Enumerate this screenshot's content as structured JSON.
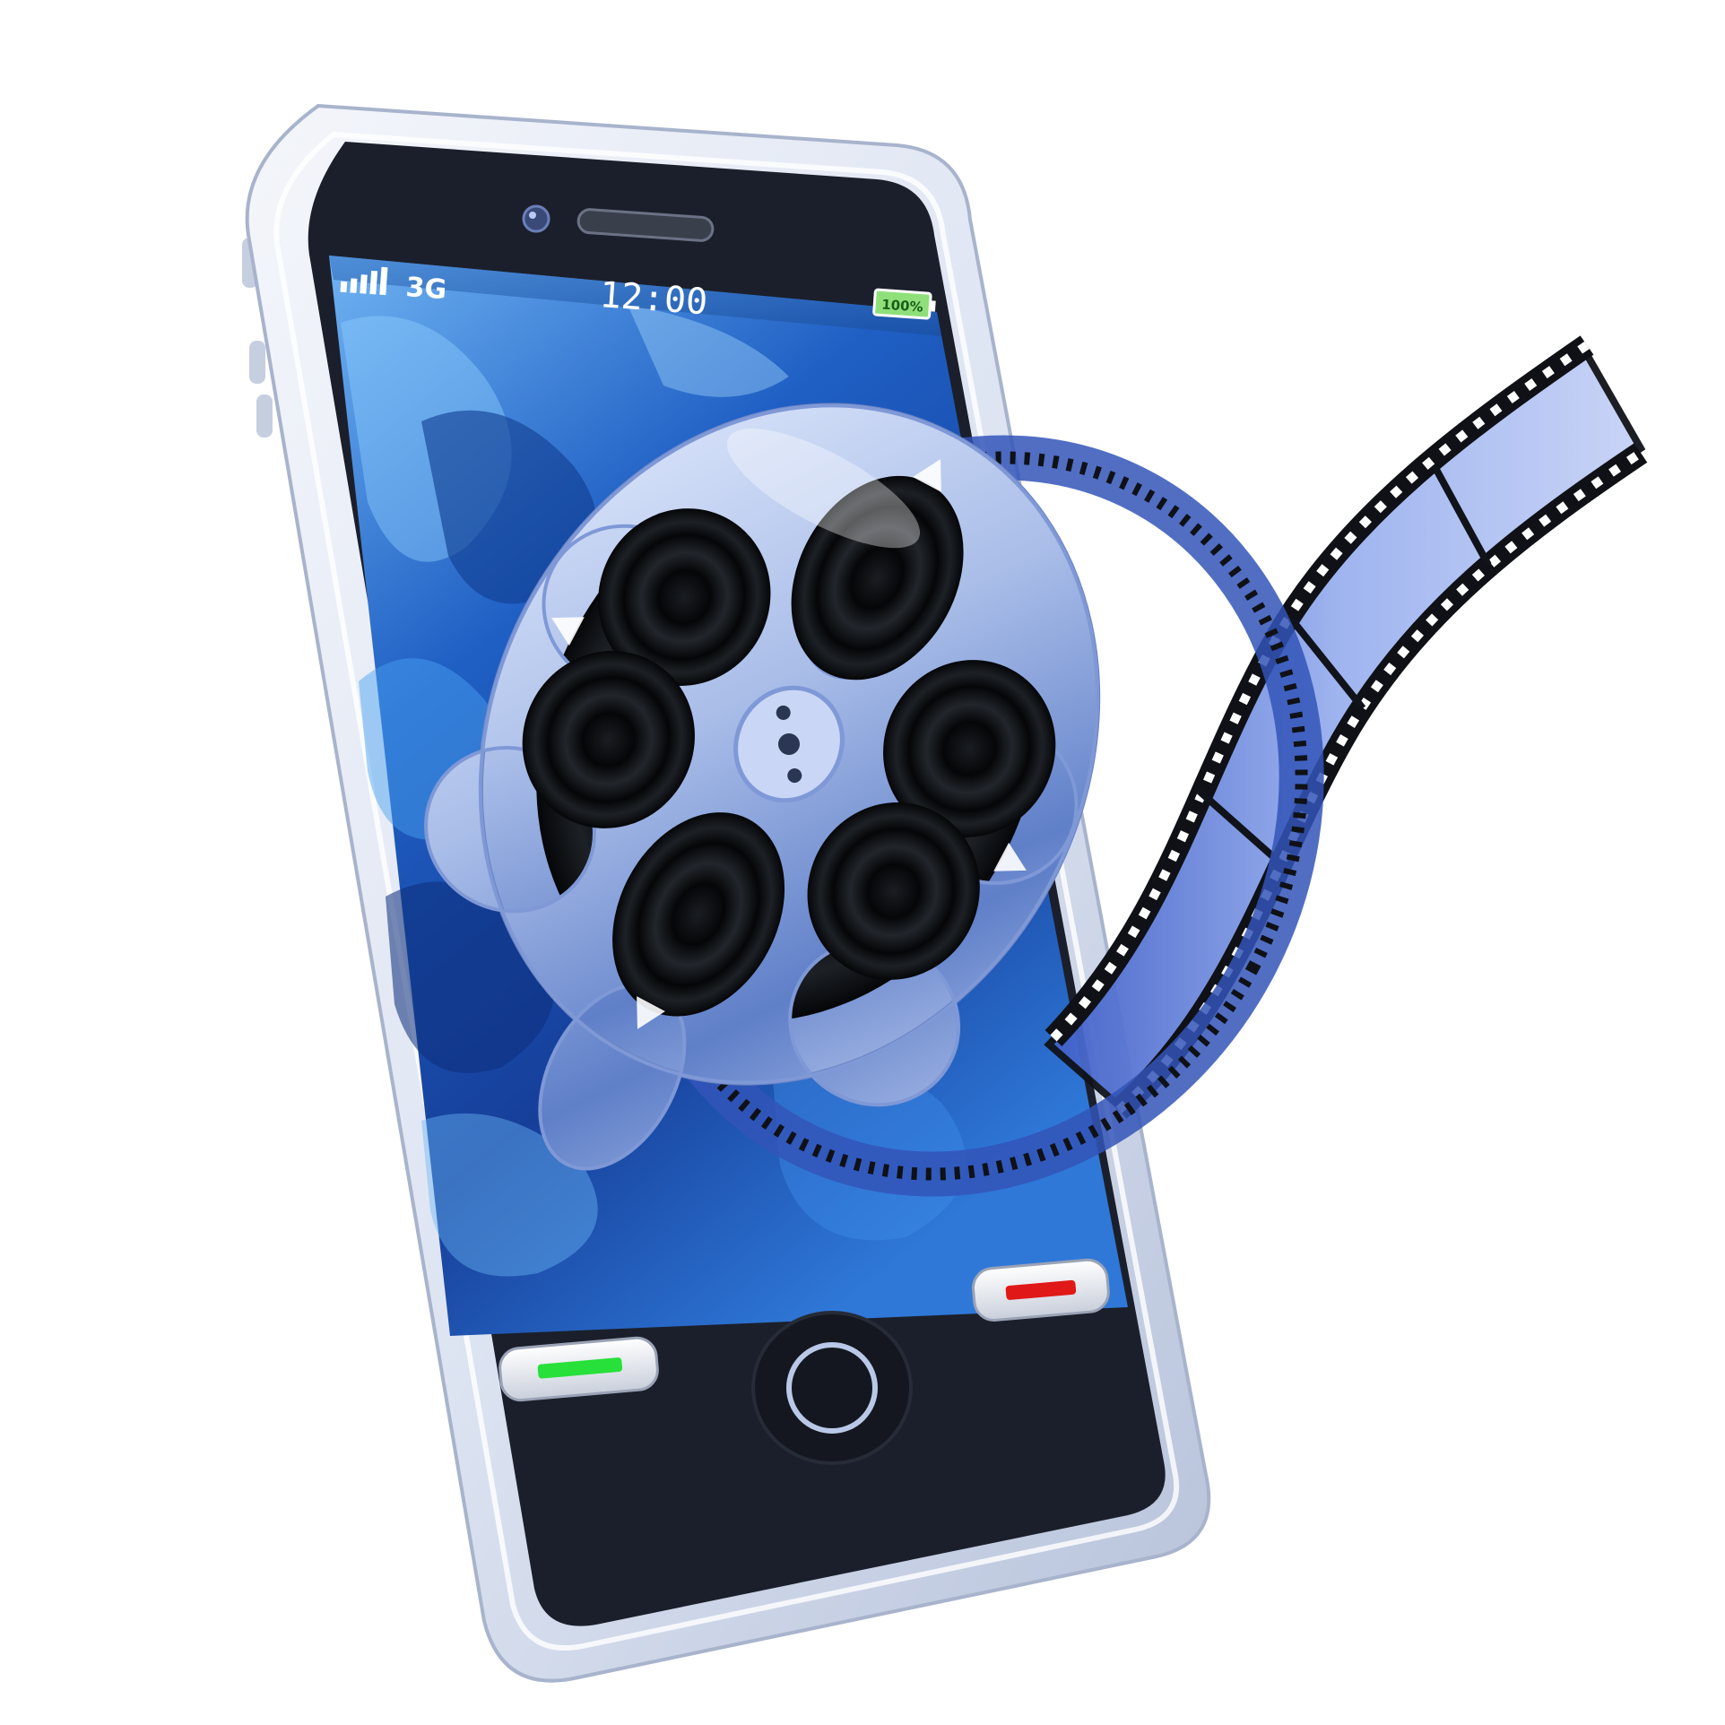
{
  "status_bar": {
    "network": "3G",
    "clock": "12:00",
    "battery": "100%",
    "signal_bars": 5
  },
  "buttons": {
    "call_color": "#27e03a",
    "end_color": "#e01818",
    "home_ring_color": "#b9c8e6"
  },
  "colors": {
    "phone_body": "#dde4f2",
    "bezel": "#1b1f2b",
    "screen_blue": "#1f5fc4",
    "reel_silver": "#a9bde8",
    "film_strip": "#7f9ae6"
  },
  "icons": [
    "signal-icon",
    "battery-icon",
    "film-reel-icon",
    "film-strip-icon",
    "home-button-icon"
  ]
}
